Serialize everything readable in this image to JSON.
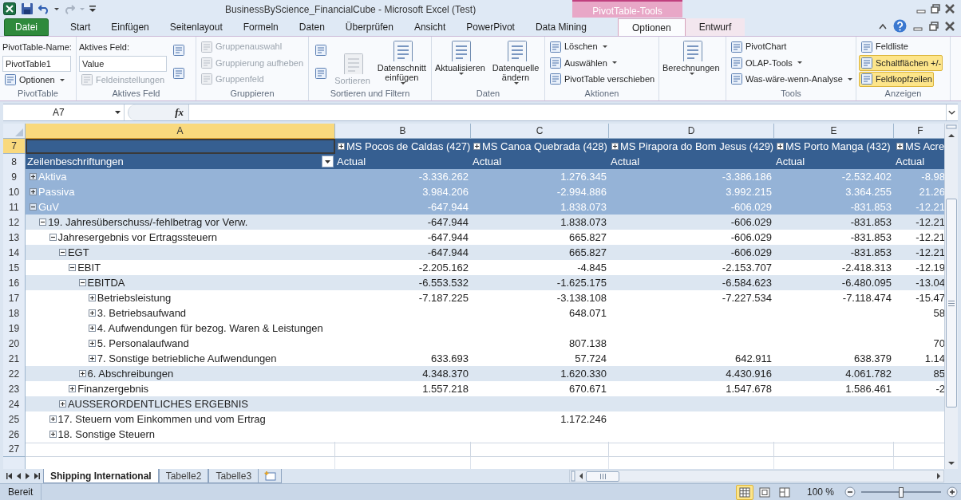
{
  "window": {
    "title": "BusinessByScience_FinancialCube  -  Microsoft Excel (Test)",
    "contextual_group": "PivotTable-Tools"
  },
  "tabs": [
    {
      "label": "Datei",
      "kind": "file",
      "selected": false
    },
    {
      "label": "Start",
      "kind": "normal",
      "selected": false
    },
    {
      "label": "Einfügen",
      "kind": "normal",
      "selected": false
    },
    {
      "label": "Seitenlayout",
      "kind": "normal",
      "selected": false
    },
    {
      "label": "Formeln",
      "kind": "normal",
      "selected": false
    },
    {
      "label": "Daten",
      "kind": "normal",
      "selected": false
    },
    {
      "label": "Überprüfen",
      "kind": "normal",
      "selected": false
    },
    {
      "label": "Ansicht",
      "kind": "normal",
      "selected": false
    },
    {
      "label": "PowerPivot",
      "kind": "normal",
      "selected": false
    },
    {
      "label": "Data Mining",
      "kind": "normal",
      "selected": false
    },
    {
      "label": "Optionen",
      "kind": "contextual",
      "selected": true
    },
    {
      "label": "Entwurf",
      "kind": "contextual",
      "selected": false
    }
  ],
  "ribbon": [
    {
      "label": "PivotTable",
      "columns": [
        [
          {
            "kind": "text",
            "label": "PivotTable-Name:"
          },
          {
            "kind": "input",
            "value": "PivotTable1"
          },
          {
            "kind": "small",
            "label": "Optionen",
            "dropdown": true,
            "disabled": false
          }
        ]
      ]
    },
    {
      "label": "Aktives Feld",
      "columns": [
        [
          {
            "kind": "text",
            "label": "Aktives Feld:"
          },
          {
            "kind": "input",
            "value": "Value"
          },
          {
            "kind": "small",
            "label": "Feldeinstellungen",
            "dropdown": false,
            "disabled": true
          }
        ],
        [
          {
            "kind": "icon"
          },
          {
            "kind": "icon"
          }
        ]
      ]
    },
    {
      "label": "Gruppieren",
      "columns": [
        [
          {
            "kind": "small",
            "label": "Gruppenauswahl",
            "dropdown": false,
            "disabled": true
          },
          {
            "kind": "small",
            "label": "Gruppierung aufheben",
            "dropdown": false,
            "disabled": true
          },
          {
            "kind": "small",
            "label": "Gruppenfeld",
            "dropdown": false,
            "disabled": true
          }
        ]
      ]
    },
    {
      "label": "Sortieren und Filtern",
      "columns": [
        [
          {
            "kind": "icon"
          },
          {
            "kind": "icon"
          }
        ],
        [
          {
            "kind": "large",
            "label": "Sortieren",
            "dropdown": false,
            "disabled": true
          }
        ],
        [
          {
            "kind": "large",
            "label": "Datenschnitt einfügen",
            "dropdown": true,
            "disabled": false
          }
        ]
      ]
    },
    {
      "label": "Daten",
      "columns": [
        [
          {
            "kind": "large",
            "label": "Aktualisieren",
            "dropdown": true,
            "disabled": false
          }
        ],
        [
          {
            "kind": "large",
            "label": "Datenquelle ändern",
            "dropdown": true,
            "disabled": false
          }
        ]
      ]
    },
    {
      "label": "Aktionen",
      "columns": [
        [
          {
            "kind": "small",
            "label": "Löschen",
            "dropdown": true,
            "disabled": false
          },
          {
            "kind": "small",
            "label": "Auswählen",
            "dropdown": true,
            "disabled": false
          },
          {
            "kind": "small",
            "label": "PivotTable verschieben",
            "dropdown": false,
            "disabled": false
          }
        ]
      ]
    },
    {
      "columns": [
        [
          {
            "kind": "large",
            "label": "Berechnungen",
            "dropdown": true,
            "disabled": false
          }
        ]
      ]
    },
    {
      "label": "Tools",
      "columns": [
        [
          {
            "kind": "small",
            "label": "PivotChart",
            "dropdown": false,
            "disabled": false
          },
          {
            "kind": "small",
            "label": "OLAP-Tools",
            "dropdown": true,
            "disabled": false
          },
          {
            "kind": "small",
            "label": "Was-wäre-wenn-Analyse",
            "dropdown": true,
            "disabled": false
          }
        ]
      ]
    },
    {
      "label": "Anzeigen",
      "columns": [
        [
          {
            "kind": "toggle",
            "label": "Feldliste",
            "selected": false
          },
          {
            "kind": "toggle",
            "label": "Schaltflächen +/-",
            "selected": true
          },
          {
            "kind": "toggle",
            "label": "Feldkopfzeilen",
            "selected": true
          }
        ]
      ]
    }
  ],
  "formula_bar": {
    "name_box": "A7",
    "function_label": "fx"
  },
  "sheet": {
    "columns": [
      {
        "letter": "A",
        "selected": true
      },
      {
        "letter": "B",
        "selected": false
      },
      {
        "letter": "C",
        "selected": false
      },
      {
        "letter": "D",
        "selected": false
      },
      {
        "letter": "E",
        "selected": false
      },
      {
        "letter": "F",
        "selected": false
      }
    ],
    "rows": [
      {
        "label": "7",
        "selected": true
      },
      {
        "label": "8",
        "selected": false
      },
      {
        "label": "9",
        "selected": false
      },
      {
        "label": "10",
        "selected": false
      },
      {
        "label": "11",
        "selected": false
      },
      {
        "label": "12",
        "selected": false
      },
      {
        "label": "13",
        "selected": false
      },
      {
        "label": "14",
        "selected": false
      },
      {
        "label": "15",
        "selected": false
      },
      {
        "label": "16",
        "selected": false
      },
      {
        "label": "17",
        "selected": false
      },
      {
        "label": "18",
        "selected": false
      },
      {
        "label": "19",
        "selected": false
      },
      {
        "label": "20",
        "selected": false
      },
      {
        "label": "21",
        "selected": false
      },
      {
        "label": "22",
        "selected": false
      },
      {
        "label": "23",
        "selected": false
      },
      {
        "label": "24",
        "selected": false
      },
      {
        "label": "25",
        "selected": false
      },
      {
        "label": "26",
        "selected": false
      },
      {
        "label": "27",
        "selected": false
      }
    ]
  },
  "pivot": {
    "column_headers": [
      "MS Pocos de Caldas (427)",
      "MS Canoa Quebrada (428)",
      "MS Pirapora do Bom Jesus (429)",
      "MS Porto Manga (432)",
      "MS Acre"
    ],
    "row_label_header": "Zeilenbeschriftungen",
    "measure_headers": [
      "Actual",
      "Actual",
      "Actual",
      "Actual",
      "Actual"
    ],
    "rows": [
      {
        "label": "Aktiva",
        "expanded": false,
        "values": {
          "B": "-3.336.262",
          "C": "1.276.345",
          "D": "-3.386.186",
          "E": "-2.532.402",
          "F": "-8.98"
        }
      },
      {
        "label": "Passiva",
        "expanded": false,
        "values": {
          "B": "3.984.206",
          "C": "-2.994.886",
          "D": "3.992.215",
          "E": "3.364.255",
          "F": "21.26"
        }
      },
      {
        "label": "GuV",
        "expanded": true,
        "values": {
          "B": "-647.944",
          "C": "1.838.073",
          "D": "-606.029",
          "E": "-831.853",
          "F": "-12.21"
        },
        "children": [
          {
            "label": "19. Jahresüberschuss/-fehlbetrag vor Verw.",
            "expanded": true,
            "values": {
              "B": "-647.944",
              "C": "1.838.073",
              "D": "-606.029",
              "E": "-831.853",
              "F": "-12.21"
            },
            "children": [
              {
                "label": "Jahresergebnis vor Ertragssteuern",
                "expanded": true,
                "values": {
                  "B": "-647.944",
                  "C": "665.827",
                  "D": "-606.029",
                  "E": "-831.853",
                  "F": "-12.21"
                },
                "children": [
                  {
                    "label": "EGT",
                    "expanded": true,
                    "values": {
                      "B": "-647.944",
                      "C": "665.827",
                      "D": "-606.029",
                      "E": "-831.853",
                      "F": "-12.21"
                    },
                    "children": [
                      {
                        "label": "EBIT",
                        "expanded": true,
                        "values": {
                          "B": "-2.205.162",
                          "C": "-4.845",
                          "D": "-2.153.707",
                          "E": "-2.418.313",
                          "F": "-12.19"
                        },
                        "children": [
                          {
                            "label": "EBITDA",
                            "expanded": true,
                            "values": {
                              "B": "-6.553.532",
                              "C": "-1.625.175",
                              "D": "-6.584.623",
                              "E": "-6.480.095",
                              "F": "-13.04"
                            },
                            "children": [
                              {
                                "label": "Betriebsleistung",
                                "expanded": false,
                                "values": {
                                  "B": "-7.187.225",
                                  "C": "-3.138.108",
                                  "D": "-7.227.534",
                                  "E": "-7.118.474",
                                  "F": "-15.47"
                                }
                              },
                              {
                                "label": "3. Betriebsaufwand",
                                "expanded": false,
                                "values": {
                                  "C": "648.071",
                                  "F": "58"
                                }
                              },
                              {
                                "label": "4. Aufwendungen für bezog. Waren & Leistungen",
                                "expanded": false
                              },
                              {
                                "label": "5. Personalaufwand",
                                "expanded": false,
                                "values": {
                                  "C": "807.138",
                                  "F": "70"
                                }
                              },
                              {
                                "label": "7. Sonstige betriebliche Aufwendungen",
                                "expanded": false,
                                "values": {
                                  "B": "633.693",
                                  "C": "57.724",
                                  "D": "642.911",
                                  "E": "638.379",
                                  "F": "1.14"
                                }
                              }
                            ]
                          },
                          {
                            "label": "6. Abschreibungen",
                            "expanded": false,
                            "values": {
                              "B": "4.348.370",
                              "C": "1.620.330",
                              "D": "4.430.916",
                              "E": "4.061.782",
                              "F": "85"
                            }
                          }
                        ]
                      },
                      {
                        "label": "Finanzergebnis",
                        "expanded": false,
                        "values": {
                          "B": "1.557.218",
                          "C": "670.671",
                          "D": "1.547.678",
                          "E": "1.586.461",
                          "F": "-2"
                        }
                      }
                    ]
                  },
                  {
                    "label": "AUSSERORDENTLICHES ERGEBNIS",
                    "expanded": false
                  }
                ]
              },
              {
                "label": "17. Steuern vom Einkommen und vom Ertrag",
                "expanded": false,
                "values": {
                  "C": "1.172.246"
                }
              },
              {
                "label": "18. Sonstige Steuern",
                "expanded": false
              }
            ]
          }
        ]
      }
    ]
  },
  "sheet_tabs": [
    {
      "label": "Shipping International",
      "selected": true
    },
    {
      "label": "Tabelle2",
      "selected": false
    },
    {
      "label": "Tabelle3",
      "selected": false
    }
  ],
  "status_bar": {
    "status": "Bereit",
    "views": [
      {
        "selected": true
      },
      {
        "selected": false
      },
      {
        "selected": false
      }
    ],
    "zoom": "100 %",
    "zoom_slider": {
      "level": 0.5
    }
  }
}
